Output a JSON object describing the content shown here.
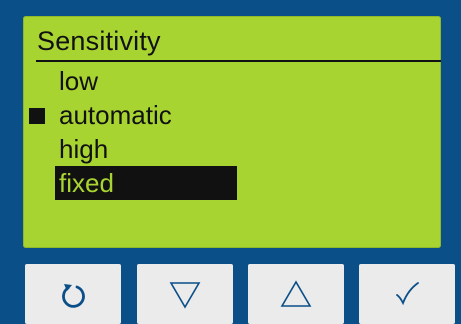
{
  "screen": {
    "title": "Sensitivity",
    "options": [
      {
        "label": "low",
        "selected": false,
        "highlighted": false
      },
      {
        "label": "automatic",
        "selected": true,
        "highlighted": false
      },
      {
        "label": "high",
        "selected": false,
        "highlighted": false
      },
      {
        "label": "fixed",
        "selected": false,
        "highlighted": true
      }
    ]
  },
  "buttons": [
    {
      "name": "back",
      "icon": "rotate-ccw-icon"
    },
    {
      "name": "down",
      "icon": "triangle-down-icon"
    },
    {
      "name": "up",
      "icon": "triangle-up-icon"
    },
    {
      "name": "confirm",
      "icon": "checkmark-icon"
    }
  ],
  "colors": {
    "frame": "#0b4f88",
    "lcd": "#a8d432",
    "ink": "#111111",
    "button": "#ebebeb",
    "icon": "#0b4f88"
  }
}
